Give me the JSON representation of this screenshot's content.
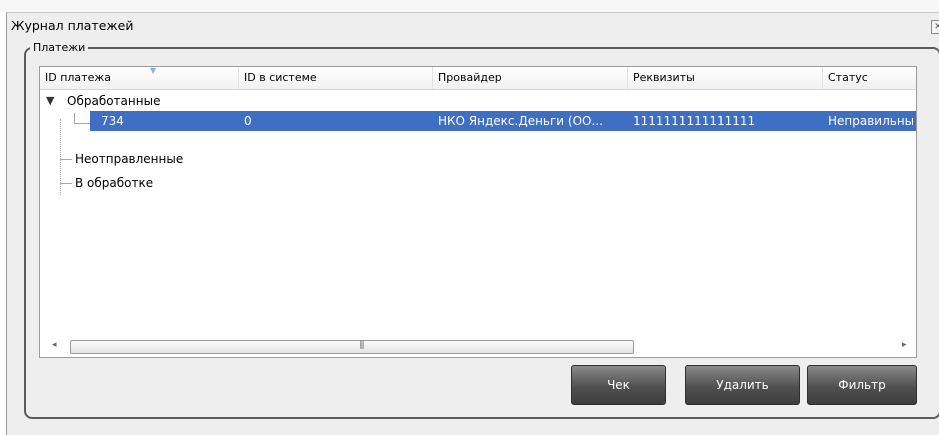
{
  "window": {
    "title": "Журнал платежей"
  },
  "group": {
    "label": "Платежи"
  },
  "table": {
    "columns": [
      "ID платежа",
      "ID в системе",
      "Провайдер",
      "Реквизиты",
      "Статус"
    ],
    "groups": [
      {
        "label": "Обработанные",
        "expanded": true,
        "rows": [
          {
            "id": "734",
            "system_id": "0",
            "provider": "НКО Яндекс.Деньги (ОО...",
            "details": "1111111111111111",
            "status": "Неправильны"
          }
        ]
      },
      {
        "label": "Неотправленные",
        "expanded": false,
        "rows": []
      },
      {
        "label": "В обработке",
        "expanded": false,
        "rows": []
      }
    ]
  },
  "scrollbar": {
    "left_icon": "◂",
    "right_icon": "▸",
    "thumb_grip": "⫼"
  },
  "buttons": {
    "check": "Чек",
    "delete": "Удалить",
    "filter": "Фильтр"
  },
  "colors": {
    "selection": "#3f6fc3",
    "button": "#505050"
  }
}
